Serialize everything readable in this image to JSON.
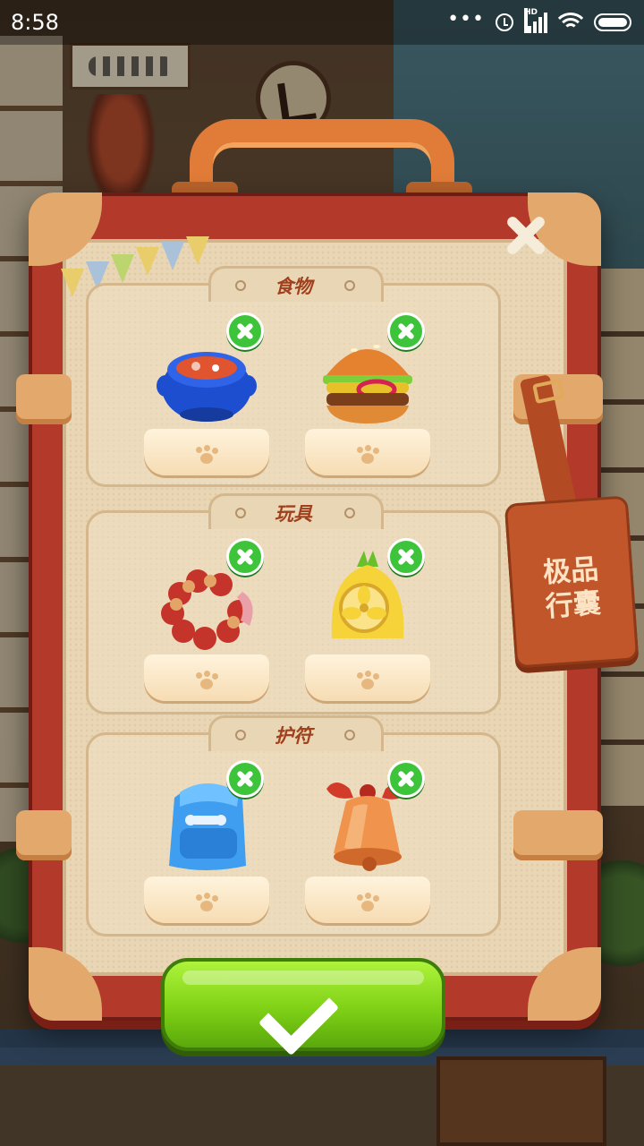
{
  "status_bar": {
    "time": "8:58",
    "signal_label": "HD",
    "dots": "•••"
  },
  "suitcase": {
    "close_icon": "crossed-bones-close-icon",
    "sections": [
      {
        "title": "食物",
        "items": [
          {
            "name": "soup-pot",
            "icon": "soup-pot-icon"
          },
          {
            "name": "burger",
            "icon": "burger-icon"
          }
        ]
      },
      {
        "title": "玩具",
        "items": [
          {
            "name": "bead-ring",
            "icon": "bead-ring-icon"
          },
          {
            "name": "pineapple-fan",
            "icon": "pineapple-fan-icon"
          }
        ]
      },
      {
        "title": "护符",
        "items": [
          {
            "name": "backpack",
            "icon": "backpack-icon"
          },
          {
            "name": "bell",
            "icon": "bell-icon"
          }
        ]
      }
    ]
  },
  "luggage_tag": {
    "line1": "极品",
    "line2": "行囊"
  },
  "confirm_button": {
    "icon": "checkmark-icon"
  },
  "colors": {
    "case_red": "#b3392a",
    "title_red": "#a0401f",
    "remove_green": "#3ec43a",
    "confirm_green": "#7fd116"
  }
}
